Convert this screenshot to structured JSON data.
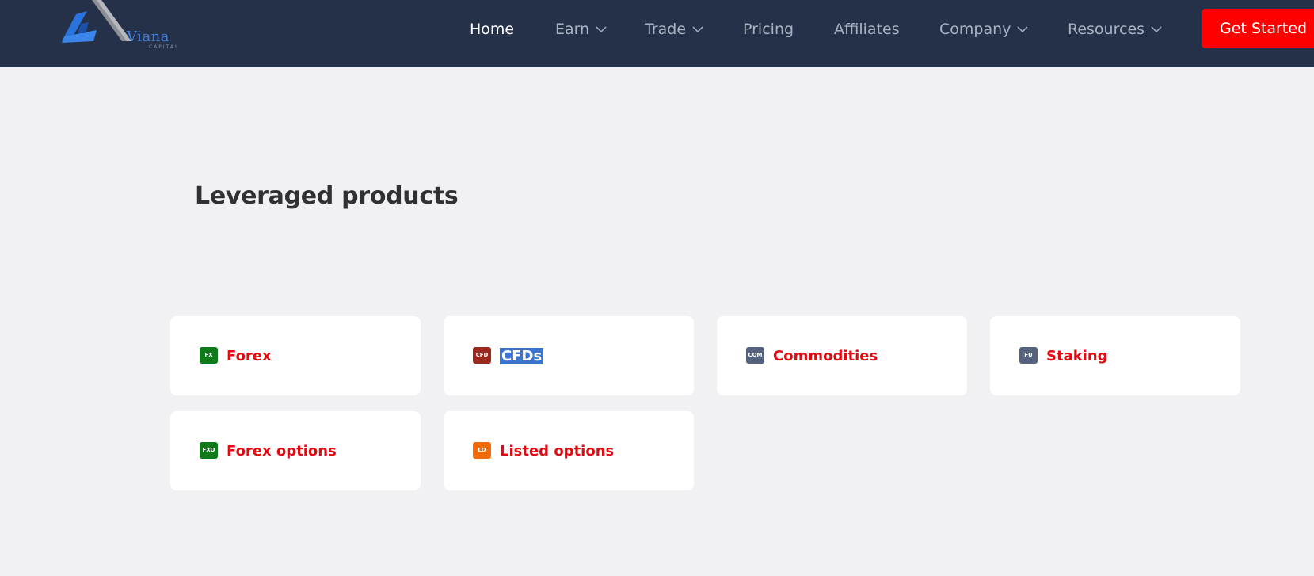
{
  "header": {
    "logo_text": "Viana",
    "logo_subtext": "CAPITAL",
    "nav": [
      {
        "label": "Home",
        "active": true,
        "dropdown": false
      },
      {
        "label": "Earn",
        "active": false,
        "dropdown": true
      },
      {
        "label": "Trade",
        "active": false,
        "dropdown": true
      },
      {
        "label": "Pricing",
        "active": false,
        "dropdown": false
      },
      {
        "label": "Affiliates",
        "active": false,
        "dropdown": false
      },
      {
        "label": "Company",
        "active": false,
        "dropdown": true
      },
      {
        "label": "Resources",
        "active": false,
        "dropdown": true
      }
    ],
    "cta_label": "Get Started"
  },
  "main": {
    "title": "Leveraged products",
    "products": [
      {
        "badge": "FX",
        "badge_color": "#0f7a1a",
        "label": "Forex"
      },
      {
        "badge": "CFD",
        "badge_color": "#9a2a1e",
        "label": "CFDs",
        "selected": true
      },
      {
        "badge": "COM",
        "badge_color": "#55627e",
        "label": "Commodities"
      },
      {
        "badge": "FU",
        "badge_color": "#55627e",
        "label": "Staking"
      },
      {
        "badge": "FXO",
        "badge_color": "#0f7a1a",
        "label": "Forex options"
      },
      {
        "badge": "LO",
        "badge_color": "#f06a0a",
        "label": "Listed options"
      }
    ]
  },
  "colors": {
    "header_bg": "#253149",
    "page_bg": "#f1f1f3",
    "accent_red": "#e10b15",
    "cta_bg": "#ff0000",
    "selection_bg": "#3a74d0"
  }
}
